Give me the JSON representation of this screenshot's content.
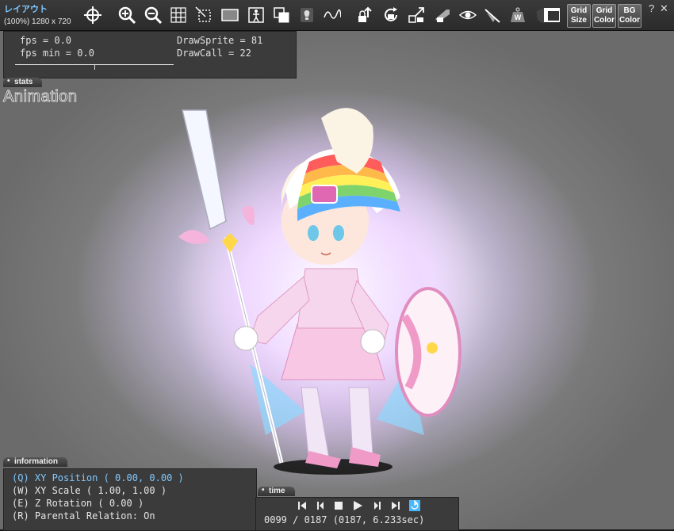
{
  "window": {
    "title": "レイアウト",
    "subtitle": "(100%) 1280 x 720"
  },
  "toolbar": {
    "icons": [
      "crosshair-icon",
      "zoom-in-icon",
      "zoom-out-icon",
      "grid-icon",
      "crop-icon",
      "frame-icon",
      "figure-icon",
      "layers-icon",
      "bulb-icon",
      "wave-icon",
      "lock-up-icon",
      "lock-rotate-icon",
      "lock-scale-icon",
      "lock-skew-icon",
      "eye-icon",
      "eye-slash-icon",
      "weight-icon",
      "shield-icon"
    ],
    "grid_size": [
      "Grid",
      "Size"
    ],
    "grid_color": [
      "Grid",
      "Color"
    ],
    "bg_color": [
      "BG",
      "Color"
    ],
    "help": "?",
    "close": "✕"
  },
  "stats": {
    "tab_label": "stats",
    "fps": "fps = 0.0",
    "fps_min": "fps min = 0.0",
    "draw_sprite": "DrawSprite = 81",
    "draw_call": "DrawCall = 22"
  },
  "animation_label": "Animation",
  "information": {
    "tab_label": "information",
    "lines": [
      "(Q) XY Position ( 0.00, 0.00 )",
      "(W) XY Scale ( 1.00, 1.00 )",
      "(E) Z Rotation ( 0.00 )",
      "(R) Parental Relation: On"
    ]
  },
  "time": {
    "tab_label": "time",
    "controls": [
      "first-frame-icon",
      "prev-frame-icon",
      "stop-icon",
      "play-icon",
      "next-frame-icon",
      "last-frame-icon",
      "loop-icon"
    ],
    "readout": "0099 / 0187 (0187, 6.233sec)"
  },
  "colors": {
    "accent": "#7fc8ff",
    "panel": "#3b3b3b",
    "viewport": "#6f6f6f"
  }
}
